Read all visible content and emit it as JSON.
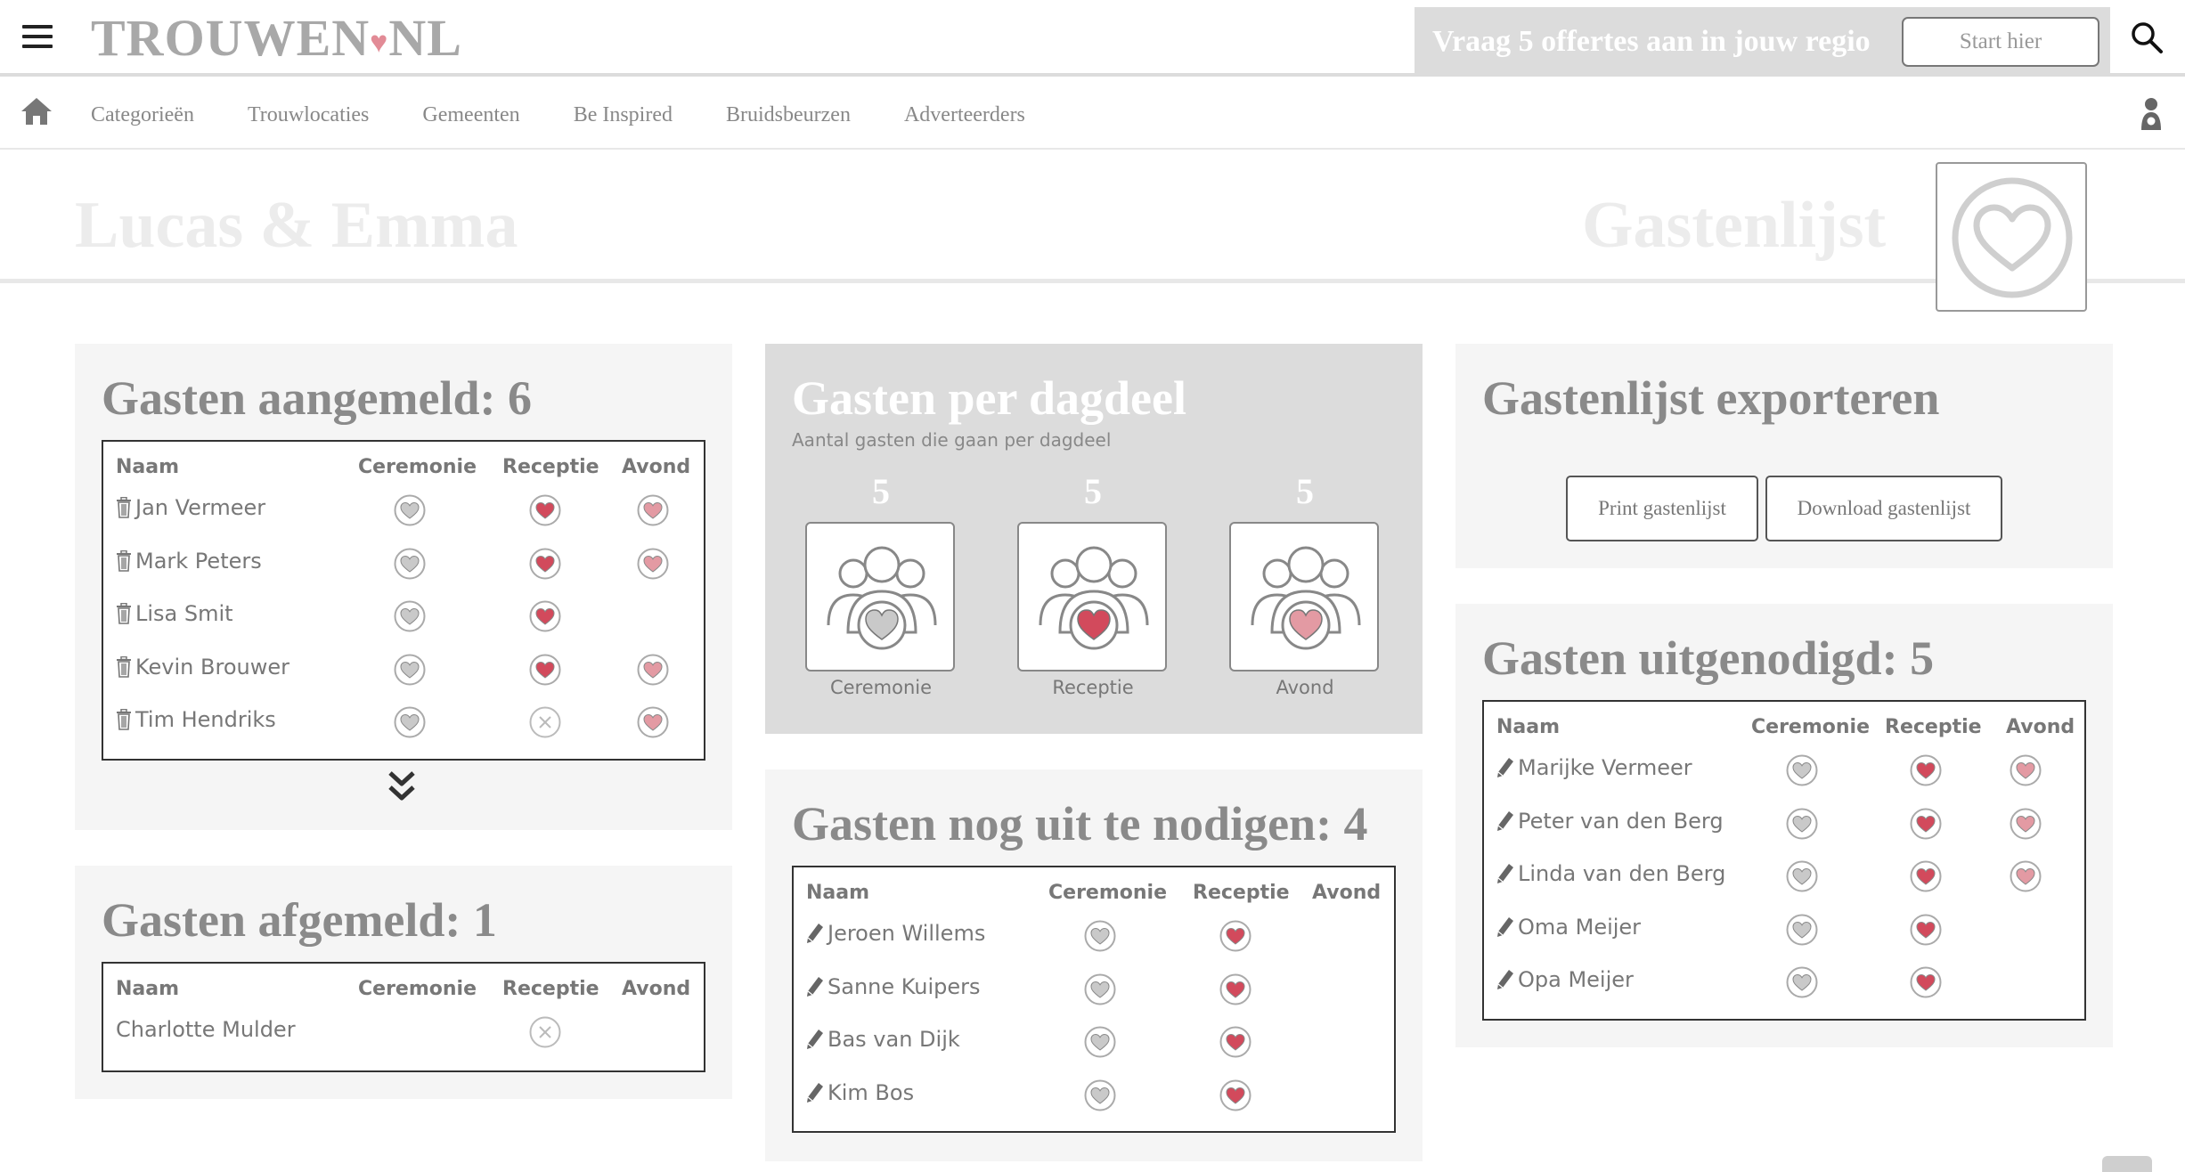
{
  "header": {
    "logo_left": "TROUWEN",
    "logo_heart": "♥",
    "logo_right": "NL",
    "offer_text": "Vraag 5 offertes aan in jouw regio",
    "start_label": "Start hier"
  },
  "nav": {
    "items": [
      "Categorieën",
      "Trouwlocaties",
      "Gemeenten",
      "Be Inspired",
      "Bruidsbeurzen",
      "Adverteerders"
    ]
  },
  "title": {
    "couple": "Lucas & Emma",
    "page": "Gastenlijst"
  },
  "columns": {
    "name": "Naam",
    "ceremony": "Ceremonie",
    "reception": "Receptie",
    "evening": "Avond"
  },
  "registered": {
    "title": "Gasten aangemeld: 6",
    "rows": [
      {
        "name": "Jan Vermeer",
        "ceremony": "grey-heart",
        "reception": "red-heart",
        "evening": "pink-heart"
      },
      {
        "name": "Mark Peters",
        "ceremony": "grey-heart",
        "reception": "red-heart",
        "evening": "pink-heart"
      },
      {
        "name": "Lisa Smit",
        "ceremony": "grey-heart",
        "reception": "red-heart",
        "evening": "none"
      },
      {
        "name": "Kevin Brouwer",
        "ceremony": "grey-heart",
        "reception": "red-heart",
        "evening": "pink-heart"
      },
      {
        "name": "Tim Hendriks",
        "ceremony": "grey-heart",
        "reception": "x",
        "evening": "pink-heart"
      }
    ]
  },
  "cancelled": {
    "title": "Gasten afgemeld: 1",
    "rows": [
      {
        "name": "Charlotte Mulder",
        "ceremony": "none",
        "reception": "x",
        "evening": "none"
      }
    ]
  },
  "daypart": {
    "title": "Gasten per dagdeel",
    "subtitle": "Aantal gasten die gaan per dagdeel",
    "parts": [
      {
        "count": "5",
        "label": "Ceremonie",
        "heart_color": "#c9c9c9"
      },
      {
        "count": "5",
        "label": "Receptie",
        "heart_color": "#d24a5c"
      },
      {
        "count": "5",
        "label": "Avond",
        "heart_color": "#e39aa3"
      }
    ]
  },
  "toinvite": {
    "title": "Gasten nog uit te nodigen: 4",
    "rows": [
      {
        "name": "Jeroen Willems",
        "ceremony": "grey-heart",
        "reception": "red-heart",
        "evening": "none"
      },
      {
        "name": "Sanne Kuipers",
        "ceremony": "grey-heart",
        "reception": "red-heart",
        "evening": "none"
      },
      {
        "name": "Bas van Dijk",
        "ceremony": "grey-heart",
        "reception": "red-heart",
        "evening": "none"
      },
      {
        "name": "Kim Bos",
        "ceremony": "grey-heart",
        "reception": "red-heart",
        "evening": "none"
      }
    ]
  },
  "export": {
    "title": "Gastenlijst exporteren",
    "print_label": "Print gastenlijst",
    "download_label": "Download gastenlijst"
  },
  "invited": {
    "title": "Gasten uitgenodigd: 5",
    "rows": [
      {
        "name": "Marijke Vermeer",
        "ceremony": "grey-heart",
        "reception": "red-heart",
        "evening": "pink-heart"
      },
      {
        "name": "Peter van den Berg",
        "ceremony": "grey-heart",
        "reception": "red-heart",
        "evening": "pink-heart"
      },
      {
        "name": "Linda van den Berg",
        "ceremony": "grey-heart",
        "reception": "red-heart",
        "evening": "pink-heart"
      },
      {
        "name": "Oma Meijer",
        "ceremony": "grey-heart",
        "reception": "red-heart",
        "evening": "none"
      },
      {
        "name": "Opa Meijer",
        "ceremony": "grey-heart",
        "reception": "red-heart",
        "evening": "none"
      }
    ]
  },
  "colors": {
    "red_heart": "#d24a5c",
    "pink_heart": "#e39aa3",
    "grey_heart": "#c9c9c9",
    "panel": "#f5f5f5",
    "panel_dark": "#dcdcdc"
  },
  "icons": {
    "menu": "hamburger-icon",
    "search": "search-icon",
    "home": "home-icon",
    "user": "user-icon",
    "delete": "trash-icon",
    "edit": "pencil-icon",
    "expand": "double-chevron-down-icon"
  }
}
